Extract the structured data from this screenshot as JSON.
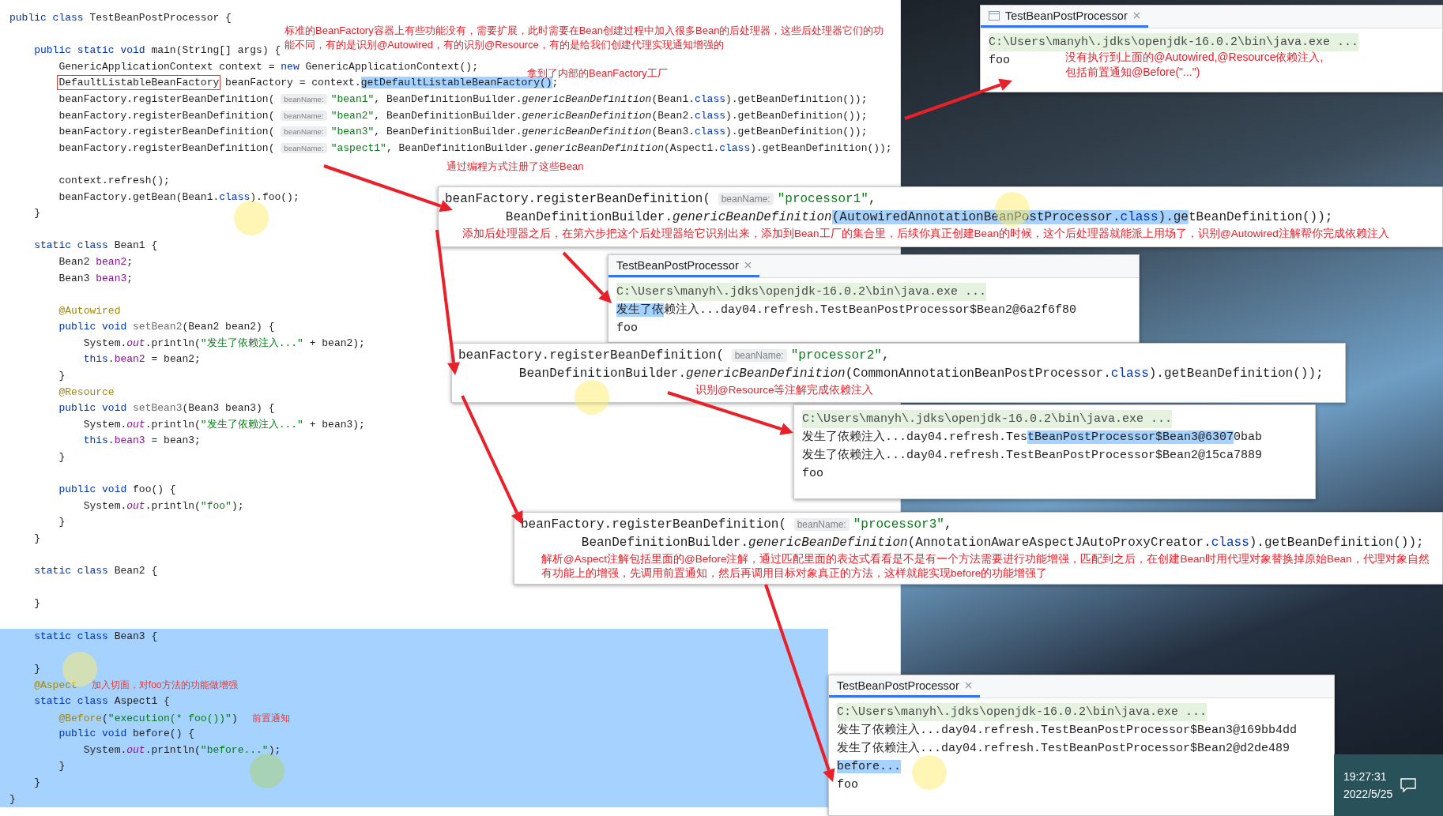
{
  "editor": {
    "lines": [
      {
        "selected": false,
        "segs": [
          {
            "kind": "kw",
            "text": "public class "
          },
          {
            "kind": "c",
            "text": "TestBeanPostProcessor {"
          }
        ]
      },
      {
        "selected": false
      },
      {
        "selected": false,
        "segs": [
          {
            "kind": "kw",
            "text": "    public static void "
          },
          {
            "kind": "c",
            "text": "main(String[] args) {"
          }
        ]
      },
      {
        "selected": false,
        "segs": [
          {
            "kind": "c",
            "text": "        GenericApplicationContext context = "
          },
          {
            "kind": "kw",
            "text": "new "
          },
          {
            "kind": "c",
            "text": "GenericApplicationContext();"
          }
        ]
      },
      {
        "selected": false,
        "segs": [
          {
            "kind": "box",
            "text": "        DefaultListableBeanFactory"
          },
          {
            "kind": "c",
            "text": " beanFactory = context."
          },
          {
            "kind": "sel",
            "text": "getDefaultListableBeanFactory()"
          },
          {
            "kind": "c",
            "text": ";"
          }
        ]
      },
      {
        "selected": false,
        "segs": [
          {
            "kind": "c",
            "text": "        beanFactory.registerBeanDefinition( "
          },
          {
            "kind": "hint",
            "text": "beanName:"
          },
          {
            "kind": "str",
            "text": "\"bean1\""
          },
          {
            "kind": "c",
            "text": ", BeanDefinitionBuilder."
          },
          {
            "kind": "it",
            "text": "genericBeanDefinition"
          },
          {
            "kind": "c",
            "text": "(Bean1."
          },
          {
            "kind": "kw",
            "text": "class"
          },
          {
            "kind": "c",
            "text": ").getBeanDefinition());"
          }
        ]
      },
      {
        "selected": false,
        "segs": [
          {
            "kind": "c",
            "text": "        beanFactory.registerBeanDefinition( "
          },
          {
            "kind": "hint",
            "text": "beanName:"
          },
          {
            "kind": "str",
            "text": "\"bean2\""
          },
          {
            "kind": "c",
            "text": ", BeanDefinitionBuilder."
          },
          {
            "kind": "it",
            "text": "genericBeanDefinition"
          },
          {
            "kind": "c",
            "text": "(Bean2."
          },
          {
            "kind": "kw",
            "text": "class"
          },
          {
            "kind": "c",
            "text": ").getBeanDefinition());"
          }
        ]
      },
      {
        "selected": false,
        "segs": [
          {
            "kind": "c",
            "text": "        beanFactory.registerBeanDefinition( "
          },
          {
            "kind": "hint",
            "text": "beanName:"
          },
          {
            "kind": "str",
            "text": "\"bean3\""
          },
          {
            "kind": "c",
            "text": ", BeanDefinitionBuilder."
          },
          {
            "kind": "it",
            "text": "genericBeanDefinition"
          },
          {
            "kind": "c",
            "text": "(Bean3."
          },
          {
            "kind": "kw",
            "text": "class"
          },
          {
            "kind": "c",
            "text": ").getBeanDefinition());"
          }
        ]
      },
      {
        "selected": false,
        "segs": [
          {
            "kind": "c",
            "text": "        beanFactory.registerBeanDefinition( "
          },
          {
            "kind": "hint",
            "text": "beanName:"
          },
          {
            "kind": "str",
            "text": "\"aspect1\""
          },
          {
            "kind": "c",
            "text": ", BeanDefinitionBuilder."
          },
          {
            "kind": "it",
            "text": "genericBeanDefinition"
          },
          {
            "kind": "c",
            "text": "(Aspect1."
          },
          {
            "kind": "kw",
            "text": "class"
          },
          {
            "kind": "c",
            "text": ").getBeanDefinition());"
          }
        ]
      },
      {
        "selected": false
      },
      {
        "selected": false,
        "segs": [
          {
            "kind": "c",
            "text": "        context.refresh();"
          }
        ]
      },
      {
        "selected": false,
        "segs": [
          {
            "kind": "c",
            "text": "        beanFactory.getBean(Bean1."
          },
          {
            "kind": "kw",
            "text": "class"
          },
          {
            "kind": "c",
            "text": ").foo();"
          }
        ]
      },
      {
        "selected": false,
        "segs": [
          {
            "kind": "c",
            "text": "    }"
          }
        ]
      },
      {
        "selected": false
      },
      {
        "selected": false,
        "segs": [
          {
            "kind": "kw",
            "text": "    static class "
          },
          {
            "kind": "c",
            "text": "Bean1 {"
          }
        ]
      },
      {
        "selected": false,
        "segs": [
          {
            "kind": "c",
            "text": "        Bean2 "
          },
          {
            "kind": "fld",
            "text": "bean2"
          },
          {
            "kind": "c",
            "text": ";"
          }
        ]
      },
      {
        "selected": false,
        "segs": [
          {
            "kind": "c",
            "text": "        Bean3 "
          },
          {
            "kind": "fld",
            "text": "bean3"
          },
          {
            "kind": "c",
            "text": ";"
          }
        ]
      },
      {
        "selected": false
      },
      {
        "selected": false,
        "segs": [
          {
            "kind": "anno",
            "text": "        @Autowired"
          }
        ]
      },
      {
        "selected": false,
        "segs": [
          {
            "kind": "kw",
            "text": "        public void "
          },
          {
            "kind": "dim",
            "text": "setBean2"
          },
          {
            "kind": "c",
            "text": "(Bean2 bean2) {"
          }
        ]
      },
      {
        "selected": false,
        "segs": [
          {
            "kind": "c",
            "text": "            System."
          },
          {
            "kind": "itf",
            "text": "out"
          },
          {
            "kind": "c",
            "text": ".println("
          },
          {
            "kind": "str",
            "text": "\"发生了依赖注入...\""
          },
          {
            "kind": "c",
            "text": " + bean2);"
          }
        ]
      },
      {
        "selected": false,
        "segs": [
          {
            "kind": "kw",
            "text": "            this"
          },
          {
            "kind": "c",
            "text": "."
          },
          {
            "kind": "fld",
            "text": "bean2"
          },
          {
            "kind": "c",
            "text": " = bean2;"
          }
        ]
      },
      {
        "selected": false,
        "segs": [
          {
            "kind": "c",
            "text": "        }"
          }
        ]
      },
      {
        "selected": false,
        "segs": [
          {
            "kind": "anno",
            "text": "        @Resource"
          }
        ]
      },
      {
        "selected": false,
        "segs": [
          {
            "kind": "kw",
            "text": "        public void "
          },
          {
            "kind": "dim",
            "text": "setBean3"
          },
          {
            "kind": "c",
            "text": "(Bean3 bean3) {"
          }
        ]
      },
      {
        "selected": false,
        "segs": [
          {
            "kind": "c",
            "text": "            System."
          },
          {
            "kind": "itf",
            "text": "out"
          },
          {
            "kind": "c",
            "text": ".println("
          },
          {
            "kind": "str",
            "text": "\"发生了依赖注入...\""
          },
          {
            "kind": "c",
            "text": " + bean3);"
          }
        ]
      },
      {
        "selected": false,
        "segs": [
          {
            "kind": "kw",
            "text": "            this"
          },
          {
            "kind": "c",
            "text": "."
          },
          {
            "kind": "fld",
            "text": "bean3"
          },
          {
            "kind": "c",
            "text": " = bean3;"
          }
        ]
      },
      {
        "selected": false,
        "segs": [
          {
            "kind": "c",
            "text": "        }"
          }
        ]
      },
      {
        "selected": false
      },
      {
        "selected": false,
        "segs": [
          {
            "kind": "kw",
            "text": "        public void "
          },
          {
            "kind": "c",
            "text": "foo() {"
          }
        ]
      },
      {
        "selected": false,
        "segs": [
          {
            "kind": "c",
            "text": "            System."
          },
          {
            "kind": "itf",
            "text": "out"
          },
          {
            "kind": "c",
            "text": ".println("
          },
          {
            "kind": "str",
            "text": "\"foo\""
          },
          {
            "kind": "c",
            "text": ");"
          }
        ]
      },
      {
        "selected": false,
        "segs": [
          {
            "kind": "c",
            "text": "        }"
          }
        ]
      },
      {
        "selected": false,
        "segs": [
          {
            "kind": "c",
            "text": "    }"
          }
        ]
      },
      {
        "selected": false
      },
      {
        "selected": false,
        "segs": [
          {
            "kind": "kw",
            "text": "    static class "
          },
          {
            "kind": "c",
            "text": "Bean2 {"
          }
        ]
      },
      {
        "selected": false
      },
      {
        "selected": false,
        "segs": [
          {
            "kind": "c",
            "text": "    }"
          }
        ]
      },
      {
        "selected": false
      },
      {
        "selected": true,
        "segs": [
          {
            "kind": "kw",
            "text": "    static class "
          },
          {
            "kind": "c",
            "text": "Bean3 {"
          }
        ]
      },
      {
        "selected": true
      },
      {
        "selected": true,
        "segs": [
          {
            "kind": "c",
            "text": "    }"
          }
        ]
      },
      {
        "selected": true,
        "segs": [
          {
            "kind": "anno",
            "text": "    @Aspect"
          },
          {
            "kind": "note",
            "text": "加入切面，对foo方法的功能做增强"
          }
        ]
      },
      {
        "selected": true,
        "segs": [
          {
            "kind": "kw",
            "text": "    static class "
          },
          {
            "kind": "c",
            "text": "Aspect1 {"
          }
        ]
      },
      {
        "selected": true,
        "segs": [
          {
            "kind": "anno",
            "text": "        @Before"
          },
          {
            "kind": "c",
            "text": "("
          },
          {
            "kind": "str",
            "text": "\"execution(* foo())\""
          },
          {
            "kind": "c",
            "text": ")"
          },
          {
            "kind": "note",
            "text": "前置通知"
          }
        ]
      },
      {
        "selected": true,
        "segs": [
          {
            "kind": "kw",
            "text": "        public void "
          },
          {
            "kind": "c",
            "text": "before() {"
          }
        ]
      },
      {
        "selected": true,
        "segs": [
          {
            "kind": "c",
            "text": "            System."
          },
          {
            "kind": "itf",
            "text": "out"
          },
          {
            "kind": "c",
            "text": ".println("
          },
          {
            "kind": "str",
            "text": "\"before...\""
          },
          {
            "kind": "c",
            "text": ");"
          }
        ]
      },
      {
        "selected": true,
        "segs": [
          {
            "kind": "c",
            "text": "        }"
          }
        ]
      },
      {
        "selected": true,
        "segs": [
          {
            "kind": "c",
            "text": "    }"
          }
        ]
      },
      {
        "selected": true,
        "segs": [
          {
            "kind": "c",
            "text": "}"
          }
        ]
      }
    ],
    "notes": [
      "标准的BeanFactory容器上有些功能没有，需要扩展，此时需要在Bean创建过程中加入很多Bean的后处理器，这些后处理器它们的功能不同，有的是识别@Autowired，有的识别@Resource，有的是给我们创建代理实现通知增强的",
      "拿到了内部的BeanFactory工厂",
      "通过编程方式注册了这些Bean"
    ]
  },
  "overlays": [
    {
      "kind": "console",
      "title": "TestBeanPostProcessor",
      "tab_icon": true,
      "command": "C:\\Users\\manyh\\.jdks\\openjdk-16.0.2\\bin\\java.exe ...",
      "lines": [
        [
          {
            "kind": "c",
            "text": "foo"
          }
        ]
      ],
      "note": "没有执行到上面的@Autowired,@Resource依赖注入,\n包括前置通知@Before(\"...\")"
    },
    {
      "kind": "snippet",
      "lines": [
        [
          {
            "kind": "c",
            "text": "beanFactory.registerBeanDefinition( "
          },
          {
            "kind": "hint",
            "text": "beanName:"
          },
          {
            "kind": "str",
            "text": "\"processor1\""
          },
          {
            "kind": "c",
            "text": ","
          }
        ],
        [
          {
            "kind": "c",
            "text": "        BeanDefinitionBuilder."
          },
          {
            "kind": "it",
            "text": "genericBeanDefinition"
          },
          {
            "kind": "sel",
            "text": "(AutowiredAnnotationBeanPostProcessor."
          },
          {
            "kind": "selkw",
            "text": "class"
          },
          {
            "kind": "sel",
            "text": ").ge"
          },
          {
            "kind": "c",
            "text": "tBeanDefinition());"
          }
        ]
      ],
      "note": "添加后处理器之后，在第六步把这个后处理器给它识别出来，添加到Bean工厂的集合里，后续你真正创建Bean的时候，这个后处理器就能派上用场了，识别@Autowired注解帮你完成依赖注入"
    },
    {
      "kind": "console",
      "title": "TestBeanPostProcessor",
      "tab_icon": false,
      "command": "C:\\Users\\manyh\\.jdks\\openjdk-16.0.2\\bin\\java.exe ...",
      "lines": [
        [
          {
            "kind": "sel",
            "text": "发生了依"
          },
          {
            "kind": "c",
            "text": "赖注入...day04.refresh.TestBeanPostProcessor$Bean2@6a2f6f80"
          }
        ],
        [
          {
            "kind": "c",
            "text": "foo"
          }
        ]
      ]
    },
    {
      "kind": "snippet",
      "lines": [
        [
          {
            "kind": "c",
            "text": "beanFactory.registerBeanDefinition( "
          },
          {
            "kind": "hint",
            "text": "beanName:"
          },
          {
            "kind": "str",
            "text": "\"processor2\""
          },
          {
            "kind": "c",
            "text": ","
          }
        ],
        [
          {
            "kind": "c",
            "text": "        BeanDefinitionBuilder."
          },
          {
            "kind": "it",
            "text": "genericBeanDefinition"
          },
          {
            "kind": "c",
            "text": "(CommonAnnotationBeanPostProcessor."
          },
          {
            "kind": "kw",
            "text": "class"
          },
          {
            "kind": "c",
            "text": ").getBeanDefinition());"
          }
        ]
      ],
      "note": "识别@Resource等注解完成依赖注入"
    },
    {
      "kind": "console",
      "command": "C:\\Users\\manyh\\.jdks\\openjdk-16.0.2\\bin\\java.exe ...",
      "lines": [
        [
          {
            "kind": "c",
            "text": "发生了依赖注入...day04.refresh.Tes"
          },
          {
            "kind": "sel",
            "text": "tBeanPostProcessor$Bean3@6307"
          },
          {
            "kind": "c",
            "text": "0bab"
          }
        ],
        [
          {
            "kind": "c",
            "text": "发生了依赖注入...day04.refresh.TestBeanPostProcessor$Bean2@15ca7889"
          }
        ],
        [
          {
            "kind": "c",
            "text": "foo"
          }
        ]
      ]
    },
    {
      "kind": "snippet",
      "lines": [
        [
          {
            "kind": "c",
            "text": "beanFactory.registerBeanDefinition( "
          },
          {
            "kind": "hint",
            "text": "beanName:"
          },
          {
            "kind": "str",
            "text": "\"processor3\""
          },
          {
            "kind": "c",
            "text": ","
          }
        ],
        [
          {
            "kind": "c",
            "text": "        BeanDefinitionBuilder."
          },
          {
            "kind": "it",
            "text": "genericBeanDefinition"
          },
          {
            "kind": "c",
            "text": "(AnnotationAwareAspectJAutoProxyCreator."
          },
          {
            "kind": "kw",
            "text": "class"
          },
          {
            "kind": "c",
            "text": ").getBeanDefinition());"
          }
        ]
      ],
      "note": "解析@Aspect注解包括里面的@Before注解，通过匹配里面的表达式看看是不是有一个方法需要进行功能增强，匹配到之后，在创建Bean时用代理对象替换掉原始Bean，代理对象自然有功能上的增强，先调用前置通知，然后再调用目标对象真正的方法，这样就能实现before的功能增强了"
    },
    {
      "kind": "console",
      "title": "TestBeanPostProcessor",
      "tab_icon": false,
      "command": "C:\\Users\\manyh\\.jdks\\openjdk-16.0.2\\bin\\java.exe ...",
      "lines": [
        [
          {
            "kind": "c",
            "text": "发生了依赖注入...day04.refresh.TestBeanPostProcessor$Bean3@169bb4dd"
          }
        ],
        [
          {
            "kind": "c",
            "text": "发生了依赖注入...day04.refresh.TestBeanPostProcessor$Bean2@d2de489"
          }
        ],
        [
          {
            "kind": "sel",
            "text": "before..."
          }
        ],
        [
          {
            "kind": "c",
            "text": "foo"
          }
        ]
      ]
    }
  ],
  "tray": {
    "time": "19:27:31",
    "date": "2022/5/25"
  }
}
